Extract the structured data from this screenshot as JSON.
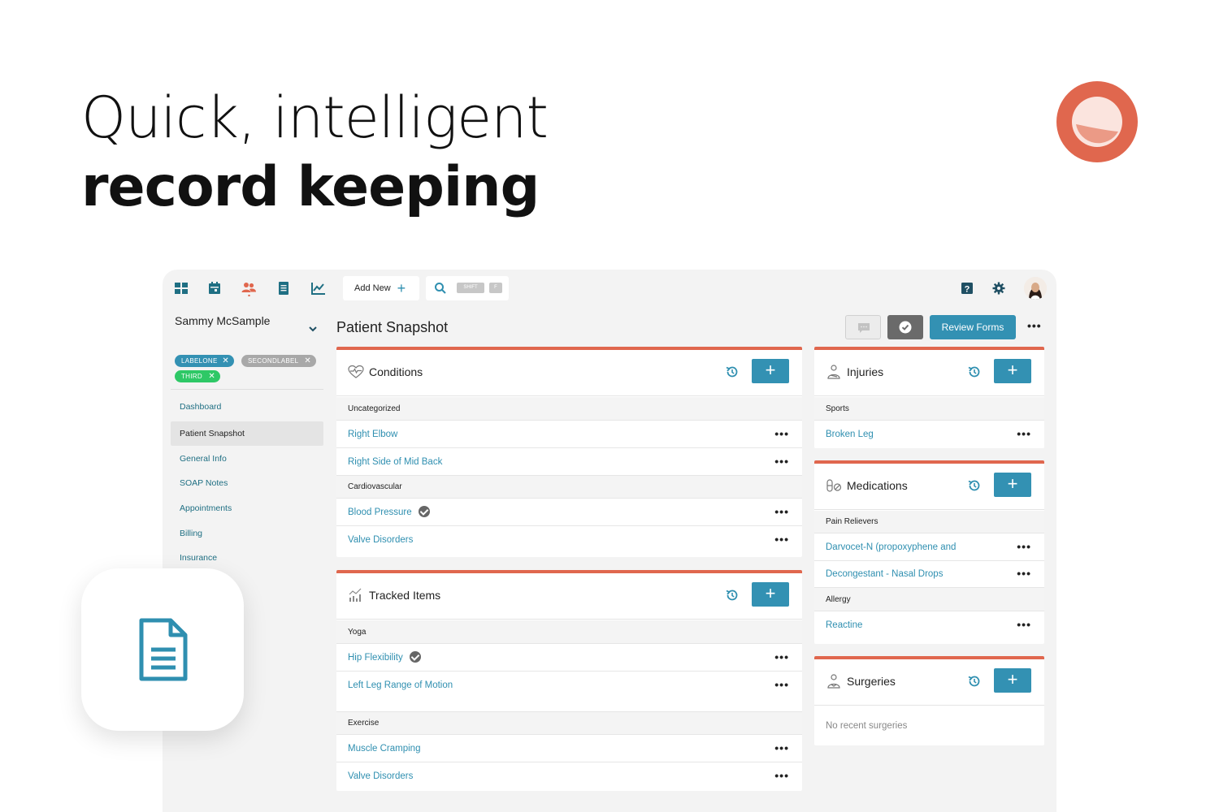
{
  "headline": {
    "line1": "Quick, intelligent",
    "line2": "record keeping"
  },
  "colors": {
    "accent": "#e0674e",
    "primary": "#3391b3",
    "link": "#2f8fb0",
    "label_blue": "#3391b3",
    "label_gray": "#a8a8a8",
    "label_green": "#2ec866"
  },
  "toolbar": {
    "nav_icons": [
      "dashboard-icon",
      "calendar-icon",
      "patients-icon",
      "notes-icon",
      "chart-icon"
    ],
    "add_new_label": "Add New",
    "search_shortcut": [
      "SHIFT",
      "F"
    ],
    "right_icons": [
      "help-icon",
      "gear-icon",
      "avatar"
    ]
  },
  "sidebar": {
    "patient_name": "Sammy McSample",
    "labels": [
      {
        "text": "LABELONE",
        "color": "#3391b3"
      },
      {
        "text": "SECONDLABEL",
        "color": "#a8a8a8"
      },
      {
        "text": "THIRD",
        "color": "#2ec866"
      }
    ],
    "items": [
      {
        "label": "Dashboard"
      },
      {
        "label": "Patient Snapshot",
        "active": true
      },
      {
        "label": "General Info"
      },
      {
        "label": "SOAP Notes"
      },
      {
        "label": "Appointments"
      },
      {
        "label": "Billing"
      },
      {
        "label": "Insurance"
      }
    ]
  },
  "main": {
    "title": "Patient Snapshot",
    "review_forms_label": "Review Forms"
  },
  "panels": {
    "conditions": {
      "title": "Conditions",
      "groups": [
        {
          "category": "Uncategorized",
          "items": [
            {
              "label": "Right Elbow"
            },
            {
              "label": "Right Side of Mid Back"
            }
          ]
        },
        {
          "category": "Cardiovascular",
          "items": [
            {
              "label": "Blood Pressure",
              "checked": true
            },
            {
              "label": "Valve Disorders"
            }
          ]
        }
      ]
    },
    "tracked": {
      "title": "Tracked Items",
      "groups": [
        {
          "category": "Yoga",
          "items": [
            {
              "label": "Hip Flexibility",
              "checked": true
            },
            {
              "label": "Left Leg Range of Motion"
            }
          ]
        },
        {
          "category": "Exercise",
          "items": [
            {
              "label": "Muscle Cramping"
            },
            {
              "label": "Valve Disorders"
            }
          ]
        }
      ]
    },
    "injuries": {
      "title": "Injuries",
      "groups": [
        {
          "category": "Sports",
          "items": [
            {
              "label": "Broken Leg"
            }
          ]
        }
      ]
    },
    "medications": {
      "title": "Medications",
      "groups": [
        {
          "category": "Pain Relievers",
          "items": [
            {
              "label": "Darvocet-N (propoxyphene and"
            },
            {
              "label": "Decongestant - Nasal Drops"
            }
          ]
        },
        {
          "category": "Allergy",
          "items": [
            {
              "label": "Reactine"
            }
          ]
        }
      ]
    },
    "surgeries": {
      "title": "Surgeries",
      "empty_text": "No recent surgeries"
    }
  }
}
